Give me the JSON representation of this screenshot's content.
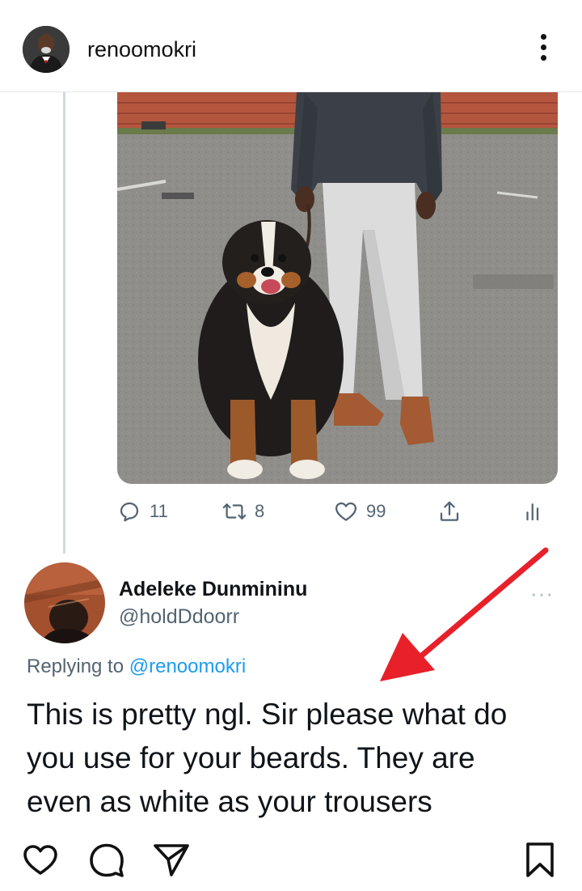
{
  "header": {
    "username": "renoomokri",
    "avatar_icon": "profile-photo",
    "more_icon": "vertical-dots-icon"
  },
  "tweet": {
    "photo_subject": "dog-and-person-photo",
    "actions": {
      "reply_count": "11",
      "retweet_count": "8",
      "like_count": "99"
    }
  },
  "reply": {
    "display_name": "Adeleke Dunmininu",
    "handle": "@holdDdoorr",
    "replying_prefix": "Replying to",
    "replying_mention": "@renoomokri",
    "text_line1": "This is pretty ngl. Sir please what do",
    "text_line2": "you use for your beards. They are",
    "text_line3": "even as white as your trousers",
    "more_label": "···"
  },
  "annotation": {
    "arrow_color": "#e8202a"
  },
  "ig_actions": {
    "icons": [
      "heart-icon",
      "comment-icon",
      "share-icon",
      "bookmark-icon"
    ]
  },
  "colors": {
    "twitter_blue": "#1d9bf0",
    "twitter_gray": "#536471",
    "thread_line": "#cfd9de"
  }
}
